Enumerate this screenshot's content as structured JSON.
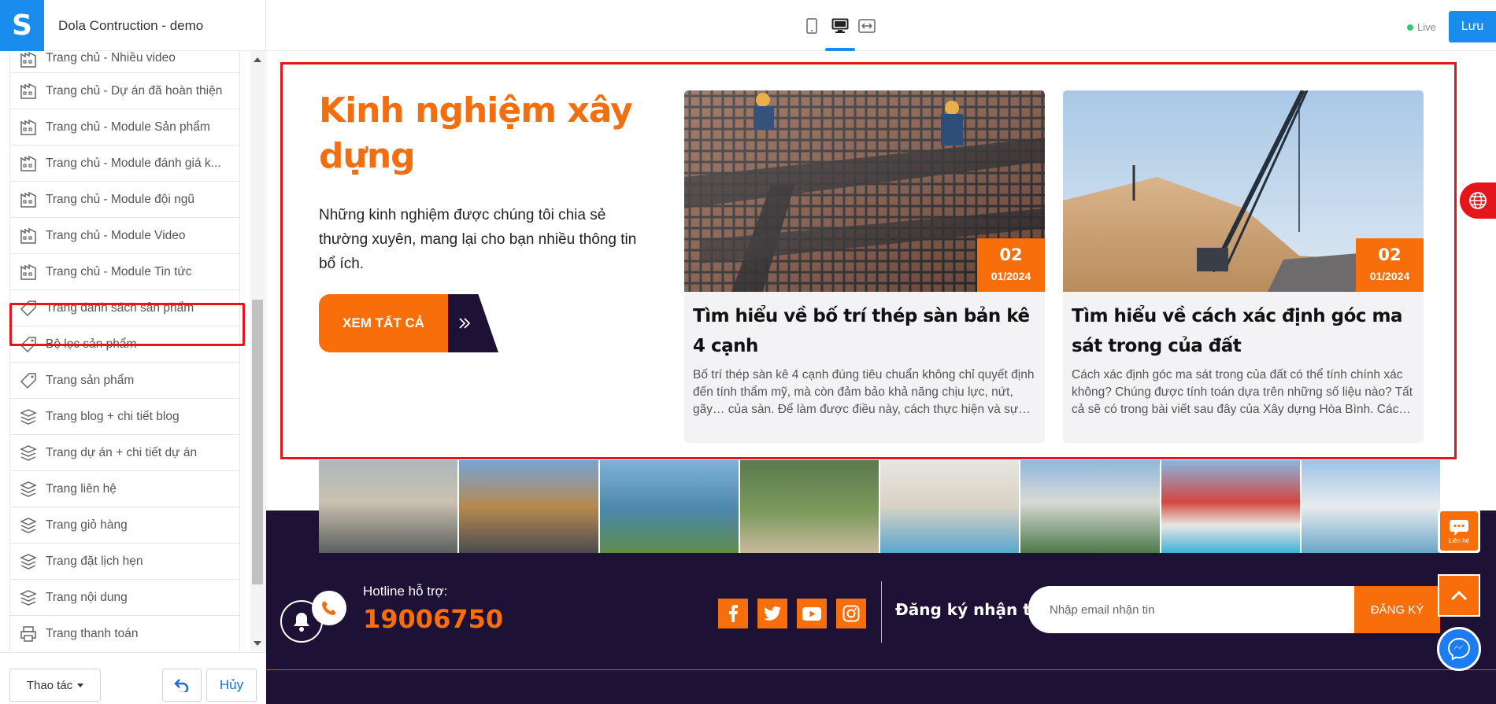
{
  "app": {
    "logo_letter": "S",
    "store_title": "Dola Contruction - demo",
    "live_label": "Live",
    "save_label": "Lưu"
  },
  "devices": [
    {
      "name": "mobile",
      "icon": "mobile-icon"
    },
    {
      "name": "desktop",
      "icon": "desktop-icon",
      "active": true
    },
    {
      "name": "fullwidth",
      "icon": "fullwidth-icon"
    }
  ],
  "sidebar": {
    "items": [
      {
        "label": "Trang chủ - Nhiều video",
        "icon": "page-layout-icon"
      },
      {
        "label": "Trang chủ - Dự án đã hoàn thiện",
        "icon": "page-layout-icon"
      },
      {
        "label": "Trang chủ - Module Sản phẩm",
        "icon": "page-layout-icon"
      },
      {
        "label": "Trang chủ - Module đánh giá k...",
        "icon": "page-layout-icon"
      },
      {
        "label": "Trang chủ - Module đội ngũ",
        "icon": "page-layout-icon"
      },
      {
        "label": "Trang chủ - Module Video",
        "icon": "page-layout-icon"
      },
      {
        "label": "Trang chủ - Module Tin tức",
        "icon": "page-layout-icon",
        "selected": true
      },
      {
        "label": "Trang danh sách sản phẩm",
        "icon": "tag-icon"
      },
      {
        "label": "Bộ lọc sản phẩm",
        "icon": "tag-icon"
      },
      {
        "label": "Trang sản phẩm",
        "icon": "tag-icon"
      },
      {
        "label": "Trang blog + chi tiết blog",
        "icon": "layers-icon"
      },
      {
        "label": "Trang dự án + chi tiết dự án",
        "icon": "layers-icon"
      },
      {
        "label": "Trang liên hệ",
        "icon": "layers-icon"
      },
      {
        "label": "Trang giỏ hàng",
        "icon": "layers-icon"
      },
      {
        "label": "Trang đặt lịch hẹn",
        "icon": "layers-icon"
      },
      {
        "label": "Trang nội dung",
        "icon": "layers-icon"
      },
      {
        "label": "Trang thanh toán",
        "icon": "printer-icon"
      }
    ],
    "actions_label": "Thao tác",
    "cancel_label": "Hủy"
  },
  "news": {
    "heading": "Kinh nghiệm xây dựng",
    "description": "Những kinh nghiệm được chúng tôi chia sẻ thường xuyên, mang lại cho bạn nhiều thông tin bổ ích.",
    "view_all_label": "XEM TẤT CẢ",
    "cards": [
      {
        "day": "02",
        "month_year": "01/2024",
        "title": "Tìm hiểu về bố trí thép sàn bản kê 4 cạnh",
        "excerpt": "Bố trí thép sàn kê 4 cạnh đúng tiêu chuẩn không chỉ quyết định đến tính thẩm mỹ, mà còn đảm bảo khả năng chịu lực, nứt, gãy… của sàn. Để làm được điều này, cách thực hiện và sự đan xen giữa các tấm sẽ ảnh hưởng trực tiếp đến chất lượng công trình.",
        "image": "rebar-grid-photo"
      },
      {
        "day": "02",
        "month_year": "01/2024",
        "title": "Tìm hiểu về cách xác định góc ma sát trong của đất",
        "excerpt": "Cách xác định góc ma sát trong của đất có thể tính chính xác không? Chúng được tính toán dựa trên những số liệu nào? Tất cả sẽ có trong bài viết sau đây của Xây dựng Hòa Bình. Các bước xác định góc nội ma sát được trình bày chi tiết.",
        "image": "sand-crane-photo"
      }
    ]
  },
  "footer": {
    "hotline_label": "Hotline hỗ trợ:",
    "hotline_number": "19006750",
    "socials": [
      "facebook-icon",
      "twitter-icon",
      "youtube-icon",
      "instagram-icon"
    ],
    "subscribe_label": "Đăng ký nhận tin",
    "subscribe_placeholder": "Nhập email nhận tin",
    "subscribe_button": "ĐĂNG KÝ",
    "contact_label": "Liên hệ"
  },
  "colors": {
    "brand_blue": "#1a8ceb",
    "accent_orange": "#f86e0b",
    "heading_orange": "#f26f11",
    "footer_navy": "#1d1236",
    "highlight_red": "#e4161c"
  }
}
